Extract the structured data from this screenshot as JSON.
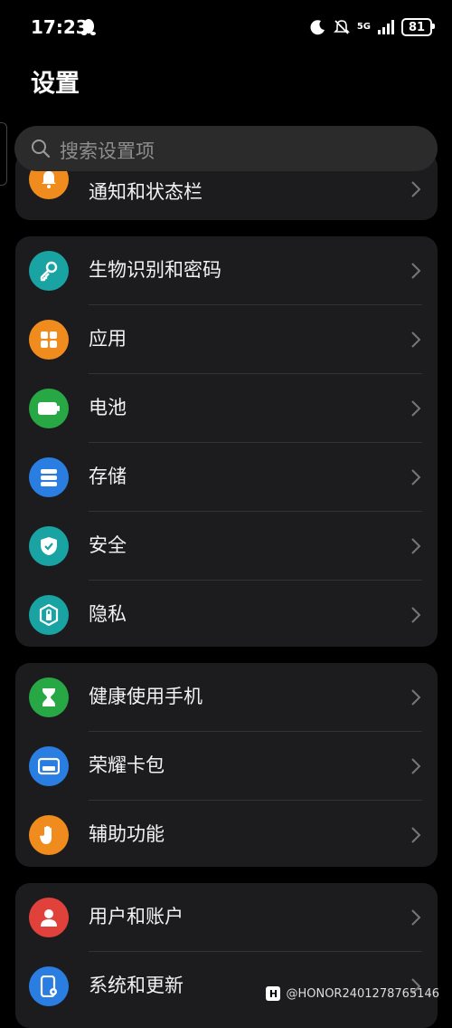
{
  "status_bar": {
    "time": "17:23",
    "network": "5G",
    "battery": "81"
  },
  "page_title": "设置",
  "search": {
    "placeholder": "搜索设置项"
  },
  "groups": [
    {
      "items": [
        {
          "label": "通知和状态栏",
          "icon": "bell-icon",
          "color": "#f08c1e"
        }
      ]
    },
    {
      "items": [
        {
          "label": "生物识别和密码",
          "icon": "key-icon",
          "color": "#1aa3a3"
        },
        {
          "label": "应用",
          "icon": "apps-grid-icon",
          "color": "#f08c1e"
        },
        {
          "label": "电池",
          "icon": "battery-icon",
          "color": "#28a745"
        },
        {
          "label": "存储",
          "icon": "storage-icon",
          "color": "#2a7de1"
        },
        {
          "label": "安全",
          "icon": "shield-icon",
          "color": "#1aa3a3"
        },
        {
          "label": "隐私",
          "icon": "privacy-lock-icon",
          "color": "#1aa3a3"
        }
      ]
    },
    {
      "items": [
        {
          "label": "健康使用手机",
          "icon": "hourglass-icon",
          "color": "#28a745"
        },
        {
          "label": "荣耀卡包",
          "icon": "wallet-icon",
          "color": "#2a7de1"
        },
        {
          "label": "辅助功能",
          "icon": "hand-icon",
          "color": "#f08c1e"
        }
      ]
    },
    {
      "items": [
        {
          "label": "用户和账户",
          "icon": "user-icon",
          "color": "#e0413a"
        },
        {
          "label": "系统和更新",
          "icon": "system-update-icon",
          "color": "#2a7de1"
        }
      ]
    }
  ],
  "watermark": {
    "logo": "H",
    "text": "@HONOR2401278765146"
  }
}
